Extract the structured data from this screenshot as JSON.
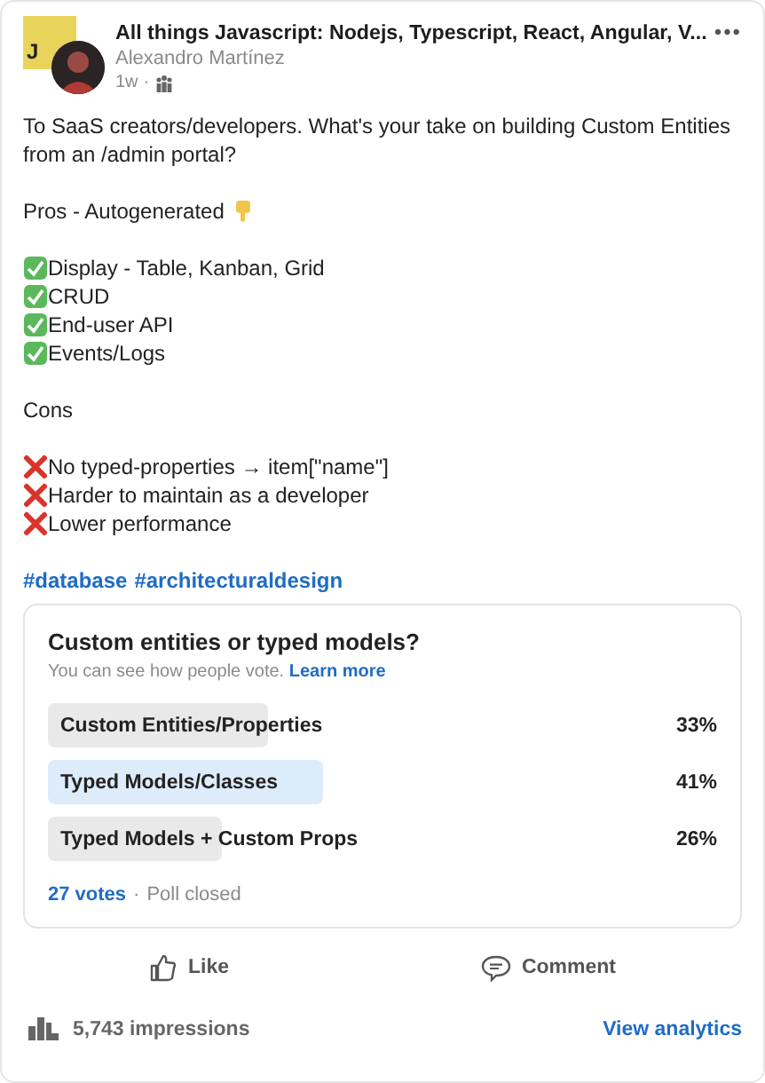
{
  "post": {
    "group_logo_text": "J",
    "group_name": "All things Javascript: Nodejs, Typescript, React, Angular, V...",
    "author": "Alexandro Martínez",
    "age": "1w",
    "separator": "·",
    "menu": "•••"
  },
  "body": [
    {
      "kind": "text",
      "text": "To SaaS creators/developers. What's your take on building Custom Entities from an /admin portal?"
    },
    {
      "kind": "blank"
    },
    {
      "kind": "pointer",
      "text": "Pros - Autogenerated"
    },
    {
      "kind": "blank"
    },
    {
      "kind": "check",
      "text": "Display - Table, Kanban, Grid"
    },
    {
      "kind": "check",
      "text": "CRUD"
    },
    {
      "kind": "check",
      "text": "End-user API"
    },
    {
      "kind": "check",
      "text": "Events/Logs"
    },
    {
      "kind": "blank"
    },
    {
      "kind": "text",
      "text": "Cons"
    },
    {
      "kind": "blank"
    },
    {
      "kind": "cross",
      "text": "No typed-properties → item[\"name\"]"
    },
    {
      "kind": "cross",
      "text": "Harder to maintain as a developer"
    },
    {
      "kind": "cross",
      "text": "Lower performance"
    },
    {
      "kind": "blank"
    }
  ],
  "hashtags": [
    "#database",
    "#architecturaldesign"
  ],
  "poll": {
    "question": "Custom entities or typed models?",
    "note": "You can see how people vote.",
    "note_link": "Learn more",
    "options": [
      {
        "label": "Custom Entities/Properties",
        "percent": "33%",
        "selected": false
      },
      {
        "label": "Typed Models/Classes",
        "percent": "41%",
        "selected": true
      },
      {
        "label": "Typed Models + Custom Props",
        "percent": "26%",
        "selected": false
      }
    ],
    "votes": "27 votes",
    "separator": "·",
    "status": "Poll closed"
  },
  "actions": [
    {
      "kind": "like",
      "label": "Like"
    },
    {
      "kind": "comment",
      "label": "Comment"
    }
  ],
  "footer": {
    "impressions": "5,743 impressions",
    "analytics": "View analytics"
  }
}
